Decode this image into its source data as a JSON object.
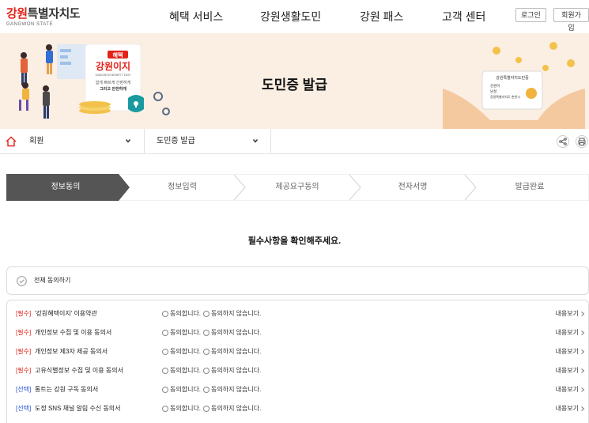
{
  "header": {
    "logo_text_accent": "강원",
    "logo_text_rest": "특별자치도",
    "logo_sub": "GANGWON STATE",
    "nav": [
      {
        "label": "혜택 서비스"
      },
      {
        "label": "강원생활도민"
      },
      {
        "label": "강원 패스"
      },
      {
        "label": "고객 센터"
      }
    ],
    "login_label": "로그인",
    "signup_label": "회원가입"
  },
  "banner": {
    "title": "도민증 발급",
    "left_sign_top": "혜택",
    "left_sign_main": "강원이지",
    "left_sign_sub": "GANGWON BENEFIT EASY",
    "left_sign_line1": "쉽게 빠르게 간편하게",
    "left_sign_line2": "그리고 안전하게",
    "card_title": "강원특별자치도민증",
    "card_line1": "강원이",
    "card_line2": "남성",
    "card_line3": "강원특별자치도 춘천시"
  },
  "breadcrumb": {
    "level1": "회원",
    "level2": "도민증 발급"
  },
  "steps": [
    {
      "label": "정보동의",
      "active": true
    },
    {
      "label": "정보입력",
      "active": false
    },
    {
      "label": "제공요구동의",
      "active": false
    },
    {
      "label": "전자서명",
      "active": false
    },
    {
      "label": "발급완료",
      "active": false
    }
  ],
  "notice": "필수사항을 확인해주세요.",
  "agree_all_label": "전체 동의하기",
  "terms": [
    {
      "tag": "[필수]",
      "kind": "req",
      "title": "'강원혜택이지' 이용약관"
    },
    {
      "tag": "[필수]",
      "kind": "req",
      "title": "개인정보 수집 및 이용 동의서"
    },
    {
      "tag": "[필수]",
      "kind": "req",
      "title": "개인정보 제3자 제공 동의서"
    },
    {
      "tag": "[필수]",
      "kind": "req",
      "title": "고유식별정보 수집 및 이용 동의서"
    },
    {
      "tag": "[선택]",
      "kind": "opt",
      "title": "통트는 강원 구독 동의서"
    },
    {
      "tag": "[선택]",
      "kind": "opt",
      "title": "도정 SNS 채널 알림 수신 동의서"
    }
  ],
  "agree_label": "동의합니다.",
  "disagree_label": "동의하지 않습니다.",
  "view_label": "내용보기",
  "colors": {
    "brand_red": "#e2231a",
    "banner_bg": "#fbeee2",
    "step_active": "#555555",
    "optional_blue": "#2350d6"
  }
}
